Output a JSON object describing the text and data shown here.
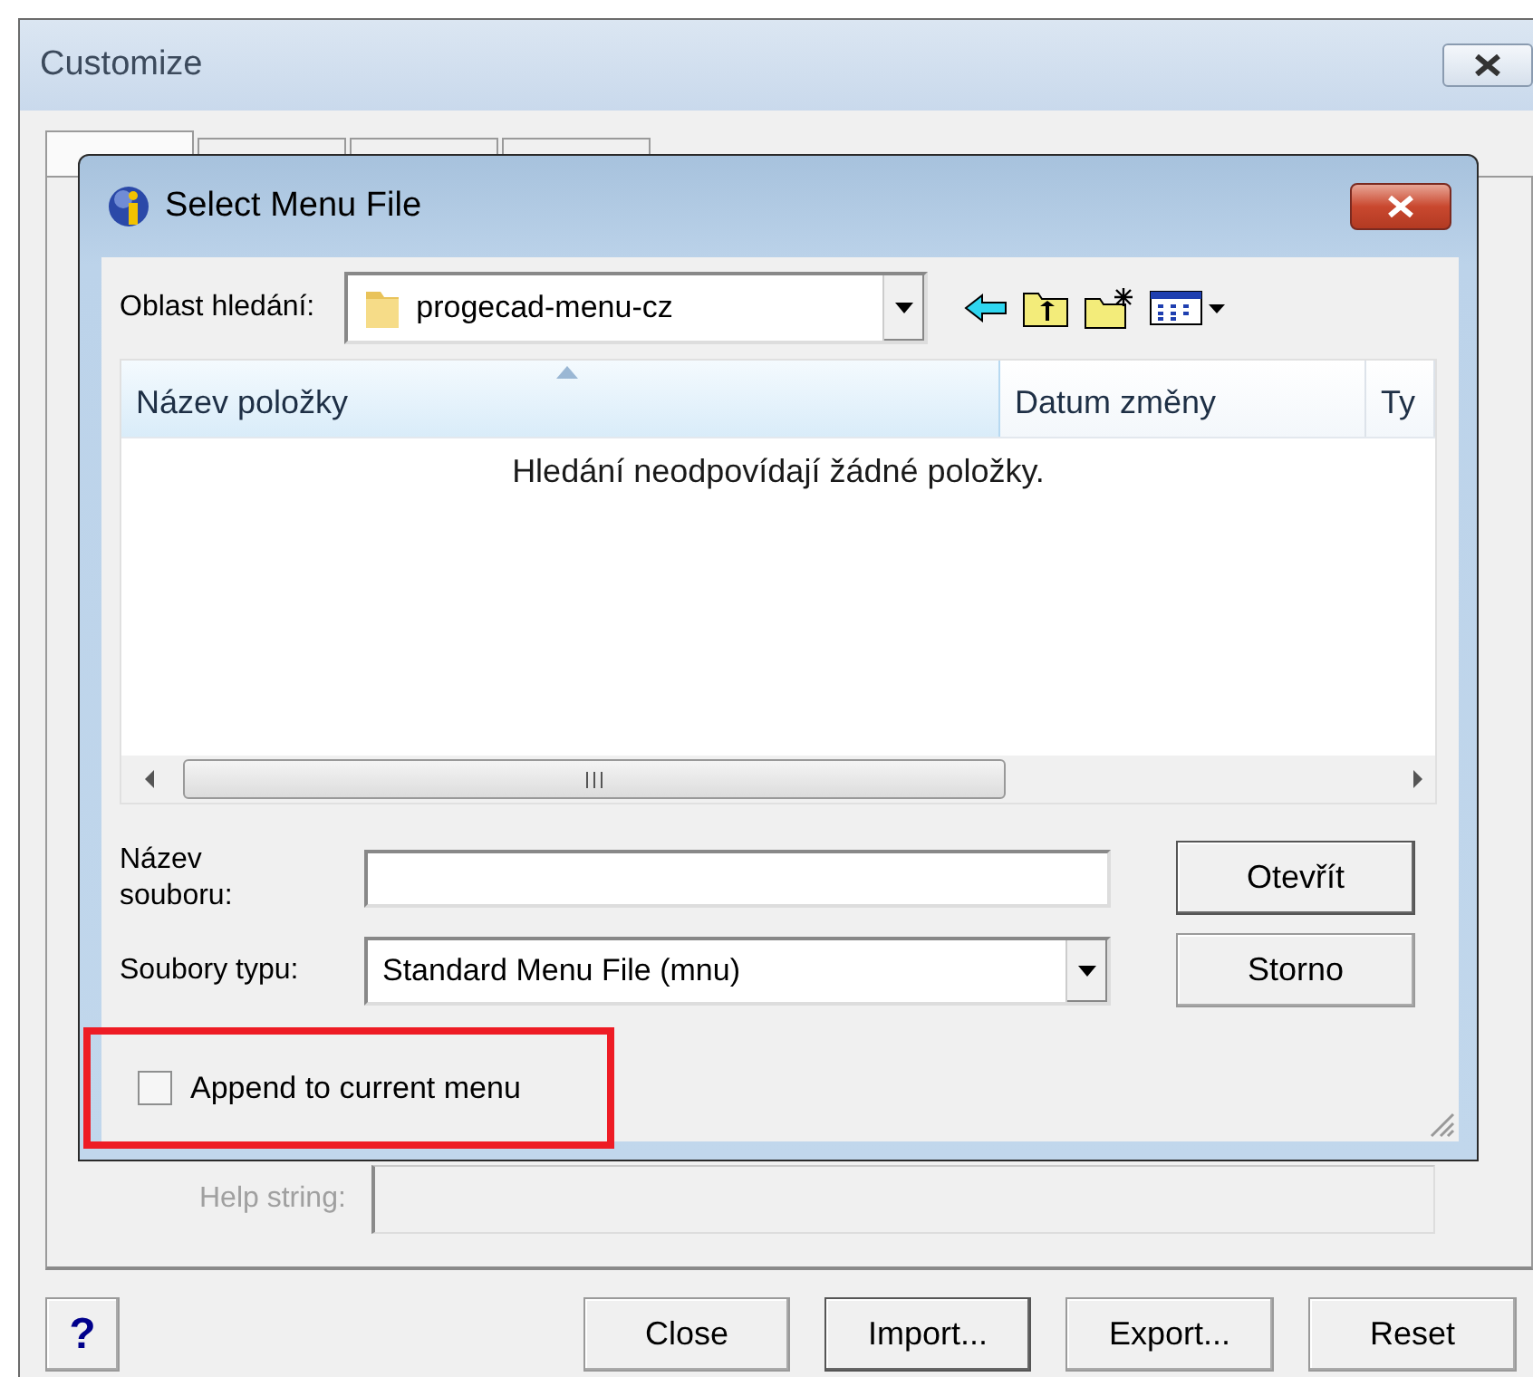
{
  "window": {
    "title": "Customize",
    "tabs": [
      {
        "selected": true
      },
      {
        "selected": false
      },
      {
        "selected": false
      },
      {
        "selected": false
      }
    ],
    "help_string": {
      "label": "Help string:",
      "disabled": true
    },
    "buttons": [
      {
        "label": "?",
        "kind": "help",
        "default": false
      },
      {
        "label": "Close",
        "kind": "text",
        "default": false
      },
      {
        "label": "Import...",
        "kind": "text",
        "default": true
      },
      {
        "label": "Export...",
        "kind": "text",
        "default": false
      },
      {
        "label": "Reset",
        "kind": "text",
        "default": false
      }
    ]
  },
  "dialog": {
    "title": "Select Menu File",
    "look_in": {
      "label": "Oblast hledání:",
      "value": "progecad-menu-cz"
    },
    "columns": [
      {
        "label": "Název položky",
        "sorted": true
      },
      {
        "label": "Datum změny",
        "sorted": false
      },
      {
        "label": "Ty",
        "sorted": false
      }
    ],
    "empty_message": "Hledání neodpovídají žádné položky.",
    "file_name": {
      "label": "Název souboru:"
    },
    "file_type": {
      "label": "Soubory typu:",
      "value": "Standard Menu File (mnu)"
    },
    "buttons": [
      {
        "label": "Otevřít",
        "default": true
      },
      {
        "label": "Storno",
        "default": false
      }
    ],
    "append": {
      "label": "Append to current menu",
      "checked": false,
      "highlighted": true
    }
  }
}
